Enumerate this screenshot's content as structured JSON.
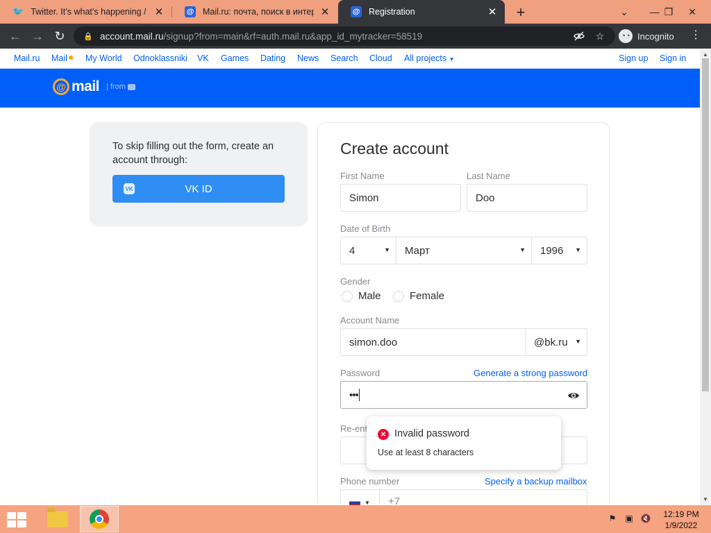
{
  "browser": {
    "tabs": [
      {
        "title": "Twitter. It’s what’s happening / Tw",
        "icon": "twitter-icon",
        "active": false
      },
      {
        "title": "Mail.ru: почта, поиск в интерне",
        "icon": "mail-ru-icon",
        "active": false
      },
      {
        "title": "Registration",
        "icon": "mail-ru-icon",
        "active": true
      }
    ],
    "url_host": "account.mail.ru",
    "url_path": "/signup?from=main&rf=auth.mail.ru&app_id_mytracker=58519",
    "incognito_label": "Incognito"
  },
  "portal": {
    "links": [
      "Mail.ru",
      "Mail",
      "My World",
      "Odnoklassniki",
      "VK",
      "Games",
      "Dating",
      "News",
      "Search",
      "Cloud",
      "All projects"
    ],
    "signup": "Sign up",
    "signin": "Sign in"
  },
  "header": {
    "logo_at": "@",
    "logo_word": "mail",
    "from": "from"
  },
  "vk_card": {
    "text": "To skip filling out the form, create an account through:",
    "button": "VK ID",
    "vk_glyph": "VK"
  },
  "form": {
    "title": "Create account",
    "first_name_label": "First Name",
    "first_name_value": "Simon",
    "last_name_label": "Last Name",
    "last_name_value": "Doo",
    "dob_label": "Date of Birth",
    "dob_day": "4",
    "dob_month": "Март",
    "dob_year": "1996",
    "gender_label": "Gender",
    "gender_male": "Male",
    "gender_female": "Female",
    "account_label": "Account Name",
    "account_value": "simon.doo",
    "domain": "@bk.ru",
    "password_label": "Password",
    "generate_link": "Generate a strong password",
    "password_value": "•••",
    "reenter_label": "Re-ent",
    "phone_label": "Phone number",
    "backup_link": "Specify a backup mailbox",
    "phone_value": "+7"
  },
  "tooltip": {
    "title": "Invalid password",
    "message": "Use at least 8 characters"
  },
  "taskbar": {
    "time": "12:19 PM",
    "date": "1/9/2022"
  },
  "colors": {
    "brand_blue": "#005ff9",
    "vk_blue": "#2f8ef4",
    "error_red": "#ed0a34",
    "logo_orange": "#ffa930"
  }
}
